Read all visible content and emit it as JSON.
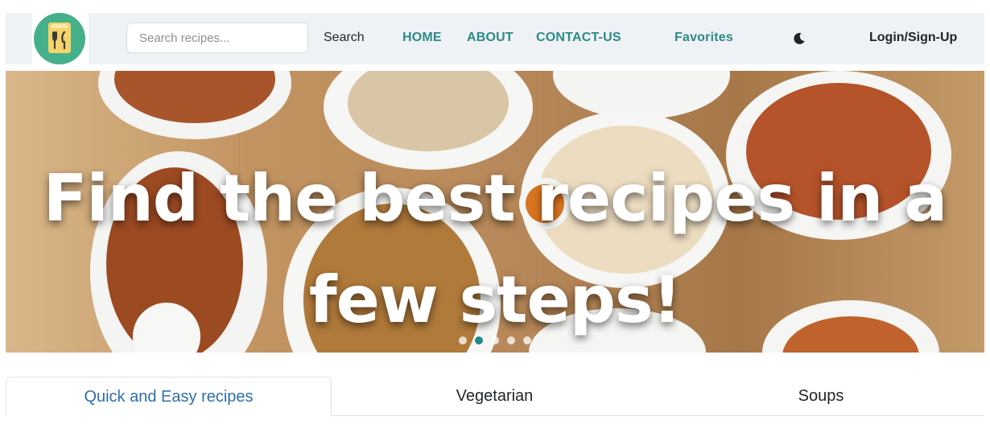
{
  "navbar": {
    "logo_icon": "cutlery-notepad-icon",
    "search": {
      "placeholder": "Search recipes...",
      "value": ""
    },
    "search_label": "Search",
    "links": [
      {
        "label": "HOME"
      },
      {
        "label": "ABOUT"
      },
      {
        "label": "CONTACT-US"
      }
    ],
    "favorites_label": "Favorites",
    "theme_icon": "moon-icon",
    "login_label": "Login/Sign-Up"
  },
  "hero": {
    "line1": "Find the best recipes in a",
    "line2": "few steps!",
    "carousel": {
      "slides": 5,
      "active_index": 1
    }
  },
  "tabs": [
    {
      "label": "Quick and Easy recipes",
      "active": true
    },
    {
      "label": "Vegetarian",
      "active": false
    },
    {
      "label": "Soups",
      "active": false
    }
  ],
  "colors": {
    "accent": "#2c8a86",
    "logo_bg": "#45b08a",
    "navbar_bg": "#eef2f6",
    "active_tab_text": "#2f6fa8"
  }
}
